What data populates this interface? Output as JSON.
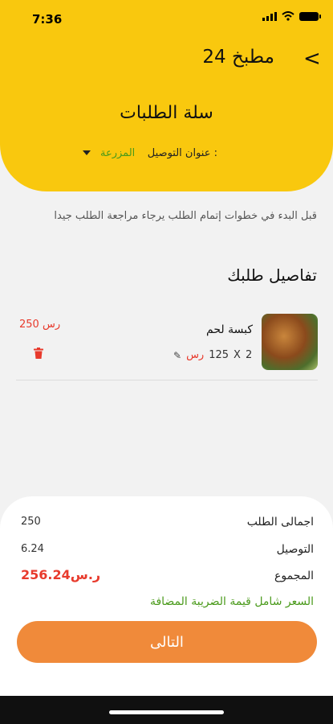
{
  "status_bar": {
    "time": "7:36"
  },
  "header": {
    "back_glyph": "<",
    "kitchen_name": "مطبخ 24",
    "page_title": "سلة الطلبات",
    "address_label": "عنوان التوصيل :",
    "address_value": "المزرعة"
  },
  "intro_text": "قبل البدء في خطوات إتمام الطلب يرجاء مراجعة الطلب جيدا",
  "order_section": {
    "title": "تفاصيل طلبك",
    "items": [
      {
        "name": "كبسة لحم",
        "quantity": "2",
        "times": "X",
        "unit_price": "125",
        "currency": "رس",
        "line_total": "250 رس"
      }
    ]
  },
  "summary": {
    "order_total_label": "اجمالى الطلب",
    "order_total_value": "250",
    "delivery_label": "التوصيل",
    "delivery_value": "6.24",
    "grand_total_label": "المجموع",
    "grand_total_value": "256.24ر.س",
    "vat_note": "السعر شامل قيمة الضريبة المضافة",
    "next_button": "التالى"
  },
  "colors": {
    "header_yellow": "#f9c80e",
    "accent_orange": "#f08a3a",
    "price_red": "#e83a2c",
    "green": "#4a9a1b"
  }
}
